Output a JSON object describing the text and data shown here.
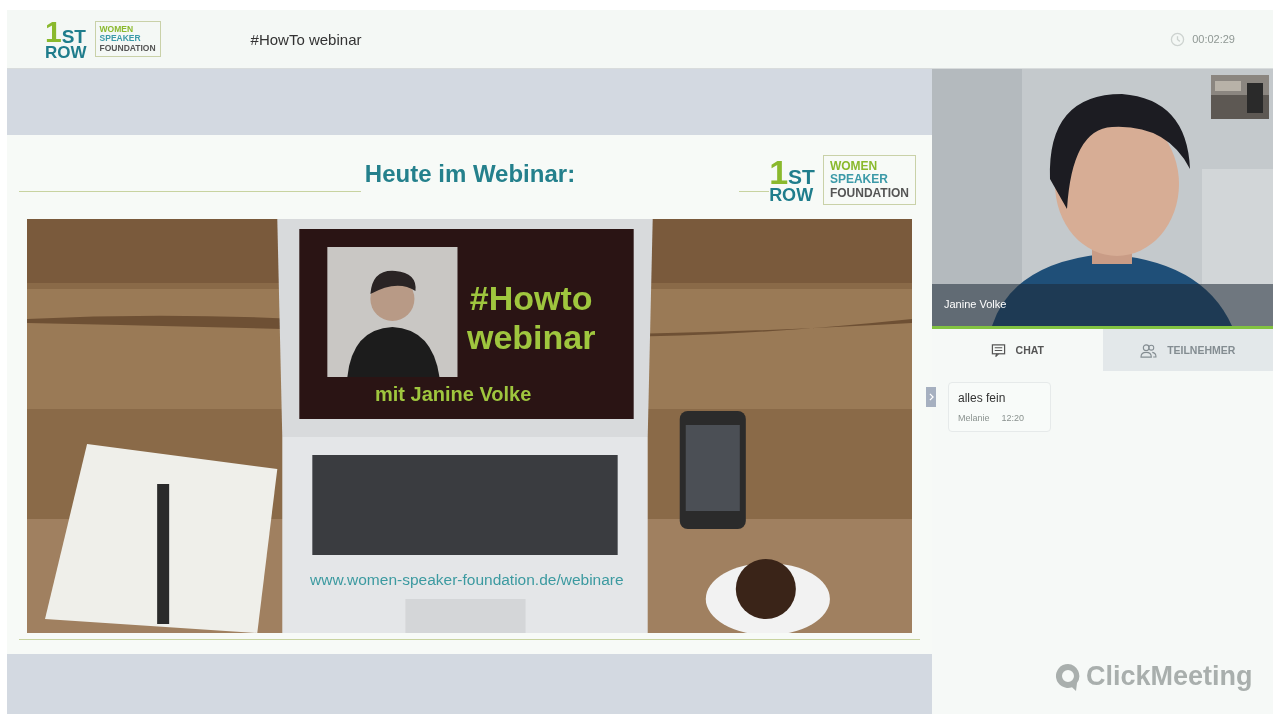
{
  "header": {
    "logo": {
      "digit": "1",
      "letters": "ST",
      "row": "ROW",
      "lines": [
        "WOMEN",
        "SPEAKER",
        "FOUNDATION"
      ]
    },
    "title": "#HowTo webinar",
    "timer": "00:02:29"
  },
  "slide": {
    "title": "Heute im Webinar:",
    "logo": {
      "digit": "1",
      "letters": "ST",
      "row": "ROW",
      "lines": [
        "WOMEN",
        "SPEAKER",
        "FOUNDATION"
      ]
    },
    "headline": [
      "#Howto",
      "webinar"
    ],
    "subline": "mit Janine Volke",
    "url": "www.women-speaker-foundation.de/webinare"
  },
  "video": {
    "presenter_name": "Janine Volke"
  },
  "tabs": [
    {
      "label": "CHAT",
      "kind": "chat",
      "selected": true
    },
    {
      "label": "TEILNEHMER",
      "kind": "people",
      "selected": false
    }
  ],
  "messages": [
    {
      "text": "alles fein",
      "author": "Melanie",
      "time": "12:20"
    }
  ],
  "brand": "ClickMeeting"
}
